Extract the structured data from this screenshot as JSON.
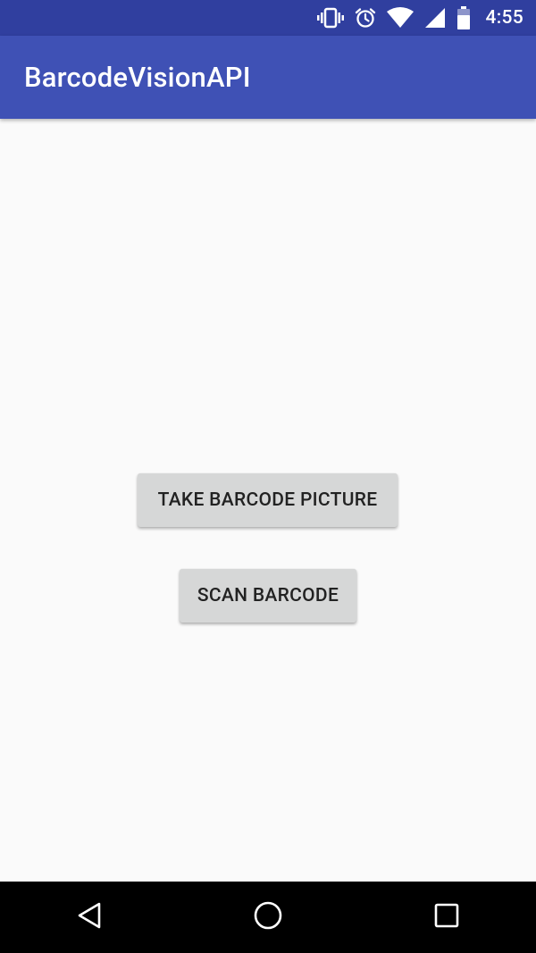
{
  "status_bar": {
    "time": "4:55",
    "icons": [
      "vibrate-icon",
      "alarm-icon",
      "wifi-icon",
      "signal-icon",
      "battery-icon"
    ]
  },
  "app_bar": {
    "title": "BarcodeVisionAPI"
  },
  "main": {
    "take_picture_label": "TAKE BARCODE PICTURE",
    "scan_barcode_label": "SCAN BARCODE"
  },
  "nav_bar": {
    "icons": [
      "back-icon",
      "home-icon",
      "recents-icon"
    ]
  },
  "colors": {
    "status_bar": "#303f9f",
    "primary": "#3f51b5",
    "background": "#fafafa",
    "button": "#d6d7d7",
    "nav_bar": "#000000"
  }
}
